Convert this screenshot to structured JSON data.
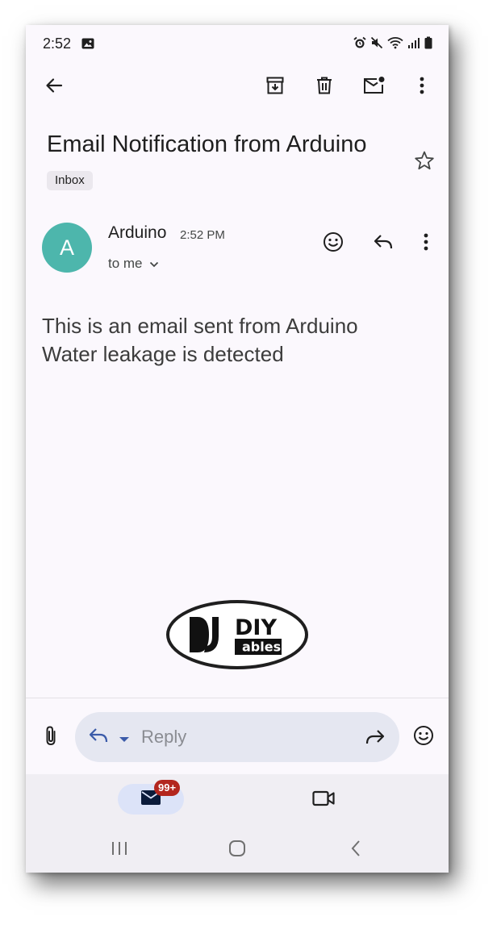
{
  "status_bar": {
    "time": "2:52"
  },
  "email": {
    "subject": "Email Notification from Arduino",
    "label_chip": "Inbox",
    "sender": {
      "avatar_letter": "A",
      "avatar_color": "#4db6ac",
      "name": "Arduino",
      "time": "2:52 PM",
      "recipient": "to me"
    },
    "body_lines": [
      "This is an email sent from Arduino",
      "Water leakage is detected"
    ]
  },
  "logo": {
    "top_text": "DIY",
    "bottom_text": "ables"
  },
  "reply_bar": {
    "placeholder": "Reply"
  },
  "bottom_nav": {
    "mail_badge": "99+",
    "badge_color": "#b3261e"
  },
  "icons": {
    "toolbar": [
      "back-arrow-icon",
      "archive-icon",
      "delete-icon",
      "mark-unread-icon",
      "more-vertical-icon"
    ],
    "sender_actions": [
      "emoji-reaction-icon",
      "reply-icon",
      "more-vertical-icon"
    ],
    "reply_bar": [
      "attachment-icon",
      "reply-icon",
      "dropdown-caret-icon",
      "forward-icon",
      "emoji-icon"
    ],
    "nav": [
      "mail-icon",
      "video-camera-icon"
    ],
    "system": [
      "recent-apps-icon",
      "home-icon",
      "system-back-icon"
    ]
  }
}
